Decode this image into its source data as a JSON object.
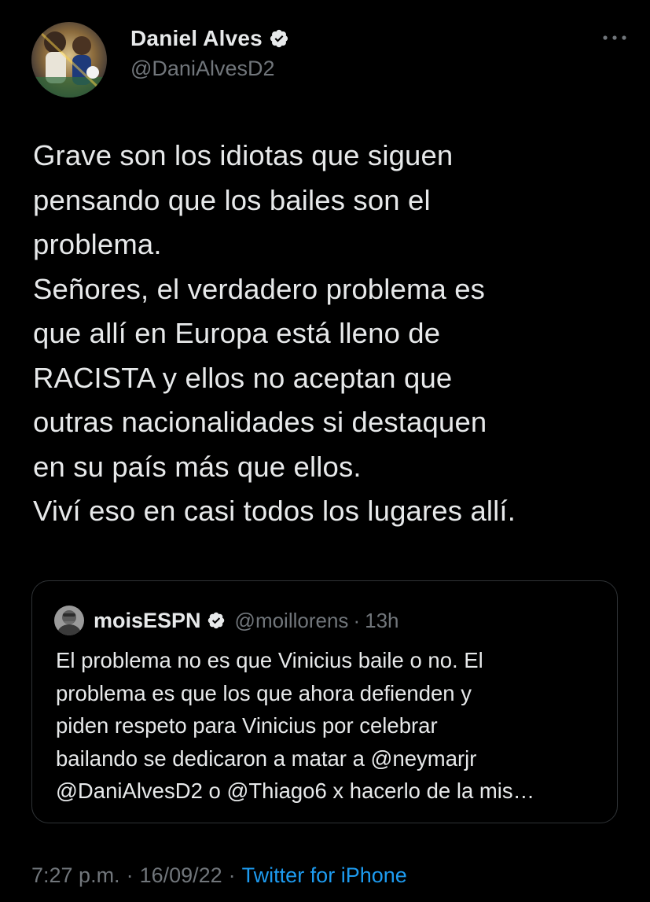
{
  "colors": {
    "background": "#000000",
    "text_primary": "#e7e9ea",
    "text_secondary": "#71767b",
    "accent": "#1d9bf0",
    "border": "#2f3336"
  },
  "tweet": {
    "author": {
      "display_name": "Daniel Alves",
      "handle": "@DaniAlvesD2",
      "verified_icon": "verified-badge-icon",
      "avatar_icon": "avatar"
    },
    "more_icon": "more-horizontal-icon",
    "text": "Grave son los idiotas que siguen\npensando que los bailes son el\nproblema.\nSeñores, el verdadero problema es\nque allí en Europa está lleno de\nRACISTA y ellos no aceptan que\noutras nacionalidades si destaquen\nen su país más que ellos.\nViví eso en casi todos los lugares allí.",
    "quoted": {
      "display_name": "moisESPN",
      "handle": "@moillorens",
      "separator": "·",
      "time": "13h",
      "text": "El problema no es que Vinicius baile o no. El\nproblema es que los que ahora defienden y\npiden respeto para Vinicius por celebrar\nbailando se dedicaron a matar a @neymarjr\n@DaniAlvesD2 o @Thiago6 x hacerlo de la mis…"
    },
    "meta": {
      "time": "7:27 p.m.",
      "separator": "·",
      "date": "16/09/22",
      "source": "Twitter for iPhone"
    }
  }
}
